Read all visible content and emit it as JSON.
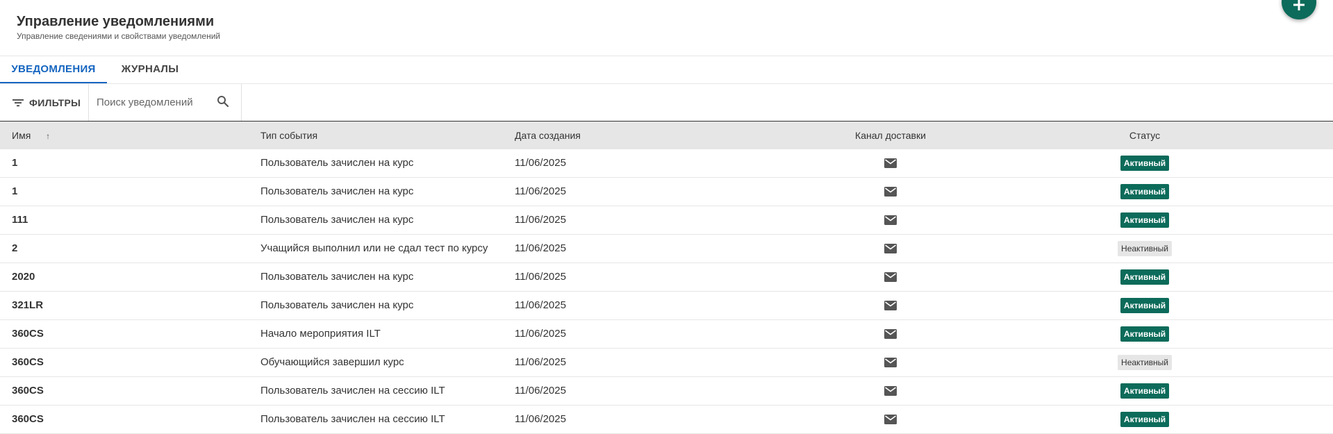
{
  "header": {
    "title": "Управление уведомлениями",
    "subtitle": "Управление сведениями и свойствами уведомлений"
  },
  "tabs": [
    {
      "label": "УВЕДОМЛЕНИЯ",
      "active": true
    },
    {
      "label": "ЖУРНАЛЫ",
      "active": false
    }
  ],
  "toolbar": {
    "filters_label": "ФИЛЬТРЫ",
    "search_placeholder": "Поиск уведомлений"
  },
  "table": {
    "columns": [
      "Имя",
      "Тип события",
      "Дата создания",
      "Канал доставки",
      "Статус"
    ],
    "sort": {
      "column": "Имя",
      "direction": "ascending",
      "icon": "arrow-up-icon"
    },
    "rows": [
      {
        "name": "1",
        "event": "Пользователь зачислен на курс",
        "date": "11/06/2025",
        "channel_icon": "mail-icon",
        "status": "Активный",
        "status_type": "active"
      },
      {
        "name": "1",
        "event": "Пользователь зачислен на курс",
        "date": "11/06/2025",
        "channel_icon": "mail-icon",
        "status": "Активный",
        "status_type": "active"
      },
      {
        "name": "111",
        "event": "Пользователь зачислен на курс",
        "date": "11/06/2025",
        "channel_icon": "mail-icon",
        "status": "Активный",
        "status_type": "active"
      },
      {
        "name": "2",
        "event": "Учащийся выполнил или не сдал тест по курсу",
        "date": "11/06/2025",
        "channel_icon": "mail-icon",
        "status": "Неактивный",
        "status_type": "inactive"
      },
      {
        "name": "2020",
        "event": "Пользователь зачислен на курс",
        "date": "11/06/2025",
        "channel_icon": "mail-icon",
        "status": "Активный",
        "status_type": "active"
      },
      {
        "name": "321LR",
        "event": "Пользователь зачислен на курс",
        "date": "11/06/2025",
        "channel_icon": "mail-icon",
        "status": "Активный",
        "status_type": "active"
      },
      {
        "name": "360CS",
        "event": "Начало мероприятия ILT",
        "date": "11/06/2025",
        "channel_icon": "mail-icon",
        "status": "Активный",
        "status_type": "active"
      },
      {
        "name": "360CS",
        "event": "Обучающийся завершил курс",
        "date": "11/06/2025",
        "channel_icon": "mail-icon",
        "status": "Неактивный",
        "status_type": "inactive"
      },
      {
        "name": "360CS",
        "event": "Пользователь зачислен на сессию ILT",
        "date": "11/06/2025",
        "channel_icon": "mail-icon",
        "status": "Активный",
        "status_type": "active"
      },
      {
        "name": "360CS",
        "event": "Пользователь зачислен на сессию ILT",
        "date": "11/06/2025",
        "channel_icon": "mail-icon",
        "status": "Активный",
        "status_type": "active"
      }
    ]
  },
  "icons": {
    "fab": "plus-icon",
    "filters": "filter-icon",
    "search": "search-icon"
  },
  "colors": {
    "accent": "#0c6b5a",
    "tab_active": "#1565c0",
    "inactive_badge": "#e6e6e6"
  }
}
